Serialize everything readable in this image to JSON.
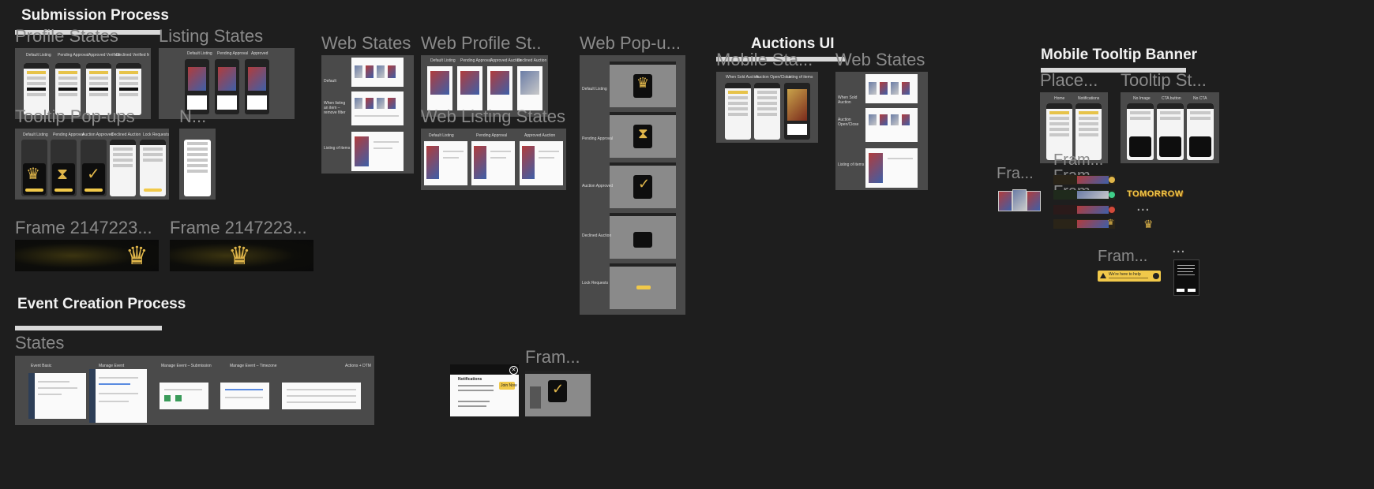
{
  "canvas": {
    "background": "#1e1e1e"
  },
  "sections": {
    "submission": "Submission Process",
    "event": "Event Creation Process",
    "auctions": "Auctions UI",
    "tooltip_banner": "Mobile Tooltip Banner"
  },
  "frames": {
    "profile_states": "Profile States",
    "listing_states": "Listing States",
    "tooltip_popups": "Tooltip Pop-ups",
    "n": "N...",
    "web_states": "Web States",
    "web_profile_states": "Web Profile St...",
    "web_listing_states": "Web Listing States",
    "web_popups": "Web Pop-u...",
    "frame_a": "Frame 2147223...",
    "frame_b": "Frame 2147223...",
    "states": "States",
    "fram_bottom": "Fram...",
    "mobile_states": "Mobile Sta...",
    "auction_web_states": "Web States",
    "placement": "Place...",
    "tooltip_states": "Tooltip St...",
    "fra": "Fra...",
    "fram1": "Fram...",
    "fram2": "Fram...",
    "fram3": "Fram...",
    "fram_right": "Fram...",
    "dots1": "...",
    "dots2": "..."
  },
  "thumbs": {
    "profile_cols": [
      "Default Listing",
      "Pending Approval",
      "Approved Verified",
      "Declined Verified Market Listing"
    ],
    "listing_cols": [
      "Default Listing",
      "Pending Approval",
      "Approved"
    ],
    "tooltip_cols": [
      "Default Listing",
      "Pending Approval",
      "Auction Approved",
      "Declined Auction",
      "Lock Requests"
    ],
    "web_profile_cols": [
      "Default Listing",
      "Pending Approval",
      "Approved Auction",
      "Declined Auction Market (pick)"
    ],
    "web_listing_cols": [
      "Default Listing",
      "Pending Approval",
      "Approved Auction"
    ],
    "web_states_rows": [
      "Default",
      "When listing an item – remove filter",
      "Listing of items"
    ],
    "web_popup_rows": [
      "Default Listing",
      "Pending Approval",
      "Auction Approved",
      "Declined Auction",
      "Lock Requests"
    ],
    "event_cols": [
      "Event Basic",
      "Manage Event",
      "Manage Event – Submission",
      "Manage Event – Timezone",
      "Actions + DTM"
    ],
    "auction_mobile_cols": [
      "When Sold Auction",
      "Auction Open/Close",
      "Listing of items"
    ],
    "placement_cols": [
      "Home",
      "Notifications"
    ],
    "tooltip_state_cols": [
      "No Image",
      "CTA button",
      "No CTA"
    ],
    "notifications_title": "Notifications",
    "notif_button": "Join Now",
    "tomorrow": "TOMORROW",
    "help_text": "We're here to help"
  },
  "colors": {
    "accent_yellow": "#f1c94a",
    "gold": "#e0b64a"
  }
}
